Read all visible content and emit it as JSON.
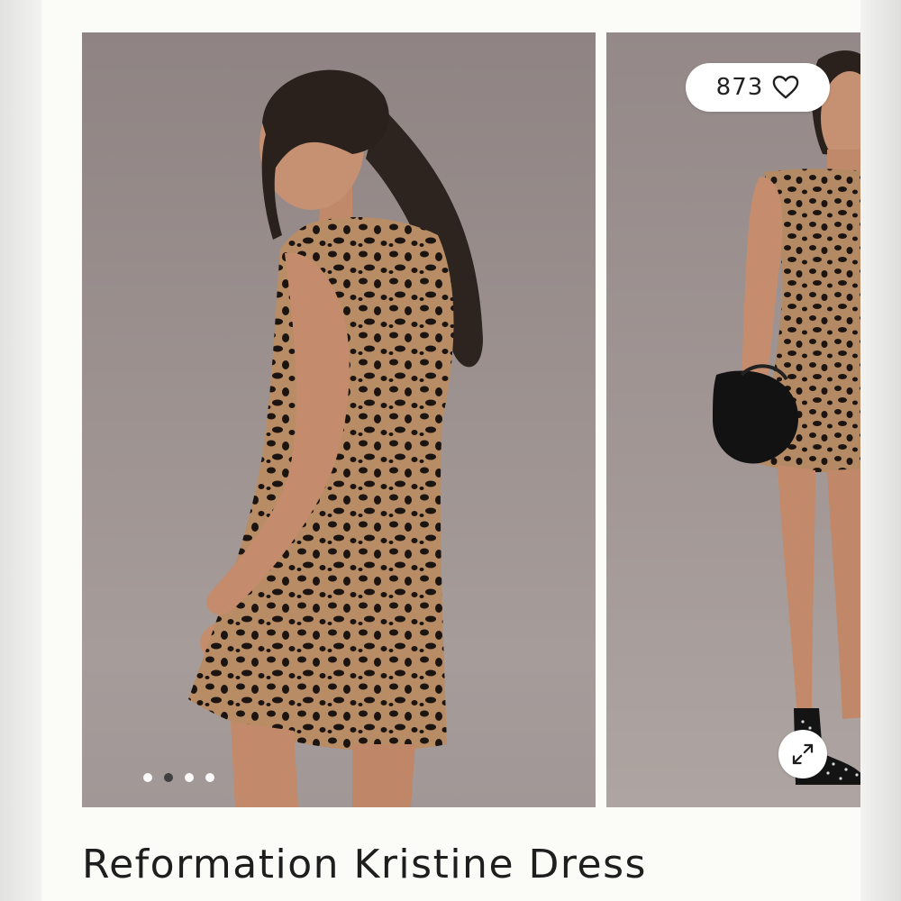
{
  "product": {
    "title": "Reformation Kristine Dress",
    "likes": "873"
  },
  "gallery": {
    "images": [
      {
        "alt": "model-back-view",
        "icon": "photo"
      },
      {
        "alt": "model-front-view-with-bag",
        "icon": "photo"
      }
    ],
    "dots": {
      "count": 4,
      "active_index": 1
    }
  },
  "icons": {
    "like": "heart-outline-icon",
    "expand": "expand-arrows-icon"
  },
  "colors": {
    "card_background": "#fbfbf7",
    "photo_backdrop": "#9c918f",
    "text": "#1e1e1e",
    "pill_background": "#ffffff"
  }
}
